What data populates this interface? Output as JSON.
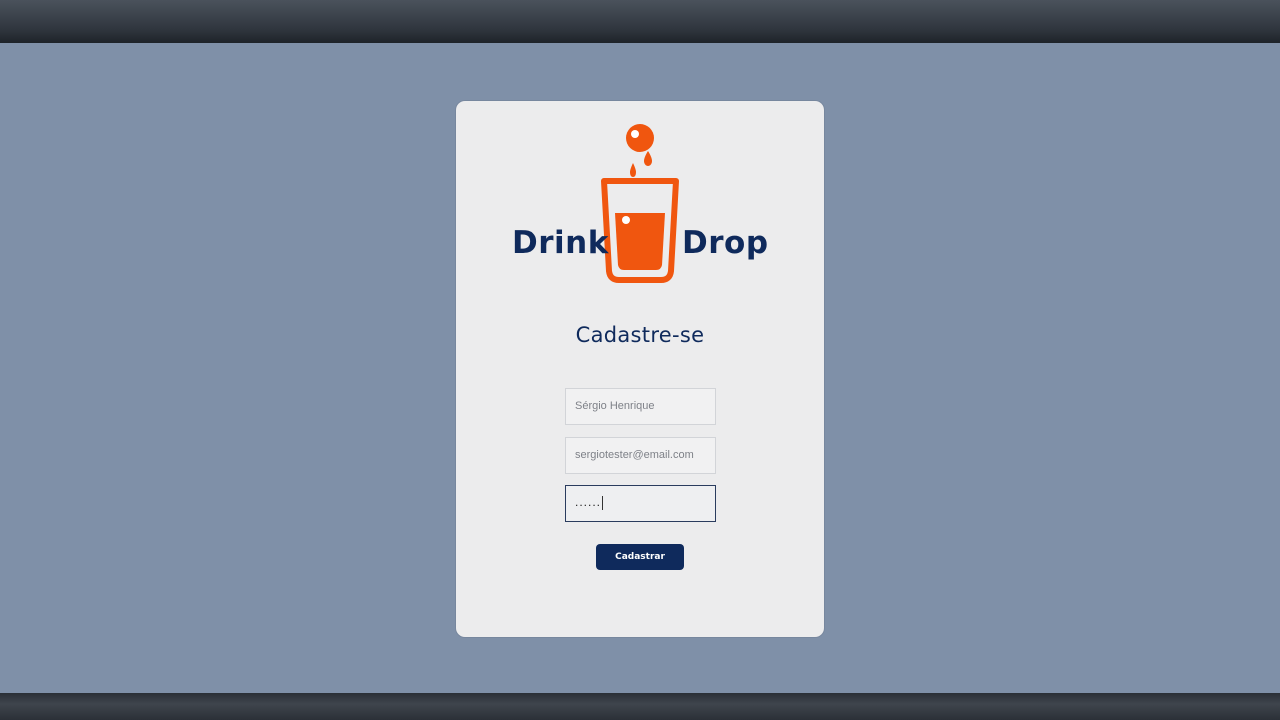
{
  "brand": {
    "word_left": "Drink",
    "word_right": "Drop",
    "primary_color": "#0f2a5c",
    "accent_color": "#f0560f",
    "logo_icon": "glass-with-drop-icon"
  },
  "form": {
    "title": "Cadastre-se",
    "name_value": "Sérgio Henrique",
    "email_value": "sergiotester@email.com",
    "password_masked": "......",
    "submit_label": "Cadastrar"
  },
  "colors": {
    "page_background": "#7f90a8",
    "card_background": "#ececed"
  }
}
